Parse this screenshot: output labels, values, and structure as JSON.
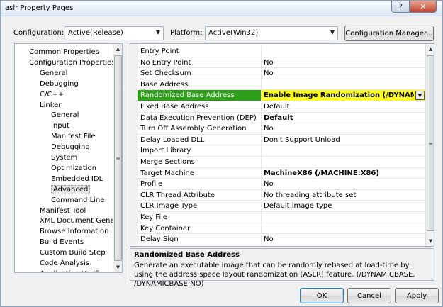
{
  "window": {
    "title": "aslr Property Pages"
  },
  "config": {
    "configuration_label": "Configuration:",
    "configuration_value": "Active(Release)",
    "platform_label": "Platform:",
    "platform_value": "Active(Win32)",
    "manager_button": "Configuration Manager..."
  },
  "tree": {
    "items": [
      {
        "label": "Common Properties",
        "level": 1
      },
      {
        "label": "Configuration Properties",
        "level": 1
      },
      {
        "label": "General",
        "level": 2
      },
      {
        "label": "Debugging",
        "level": 2
      },
      {
        "label": "C/C++",
        "level": 2
      },
      {
        "label": "Linker",
        "level": 2
      },
      {
        "label": "General",
        "level": 3
      },
      {
        "label": "Input",
        "level": 3
      },
      {
        "label": "Manifest File",
        "level": 3
      },
      {
        "label": "Debugging",
        "level": 3
      },
      {
        "label": "System",
        "level": 3
      },
      {
        "label": "Optimization",
        "level": 3
      },
      {
        "label": "Embedded IDL",
        "level": 3
      },
      {
        "label": "Advanced",
        "level": 3,
        "selected": true
      },
      {
        "label": "Command Line",
        "level": 3
      },
      {
        "label": "Manifest Tool",
        "level": 2
      },
      {
        "label": "XML Document Genera",
        "level": 2
      },
      {
        "label": "Browse Information",
        "level": 2
      },
      {
        "label": "Build Events",
        "level": 2
      },
      {
        "label": "Custom Build Step",
        "level": 2
      },
      {
        "label": "Code Analysis",
        "level": 2
      },
      {
        "label": "Application Verifi",
        "level": 2
      }
    ]
  },
  "properties": [
    {
      "name": "Entry Point",
      "value": ""
    },
    {
      "name": "No Entry Point",
      "value": "No"
    },
    {
      "name": "Set Checksum",
      "value": "No"
    },
    {
      "name": "Base Address",
      "value": ""
    },
    {
      "name": "Randomized Base Address",
      "value": "Enable Image Randomization (/DYNAMICBASE)",
      "selected": true
    },
    {
      "name": "Fixed Base Address",
      "value": "Default"
    },
    {
      "name": "Data Execution Prevention (DEP)",
      "value": "Default",
      "bold": true
    },
    {
      "name": "Turn Off Assembly Generation",
      "value": "No"
    },
    {
      "name": "Delay Loaded DLL",
      "value": "Don't Support Unload"
    },
    {
      "name": "Import Library",
      "value": ""
    },
    {
      "name": "Merge Sections",
      "value": ""
    },
    {
      "name": "Target Machine",
      "value": "MachineX86 (/MACHINE:X86)",
      "bold": true
    },
    {
      "name": "Profile",
      "value": "No"
    },
    {
      "name": "CLR Thread Attribute",
      "value": "No threading attribute set"
    },
    {
      "name": "CLR Image Type",
      "value": "Default image type"
    },
    {
      "name": "Key File",
      "value": ""
    },
    {
      "name": "Key Container",
      "value": ""
    },
    {
      "name": "Delay Sign",
      "value": "No"
    }
  ],
  "description": {
    "title": "Randomized Base Address",
    "text": "Generate an executable image that can be randomly rebased at load-time by using the address space layout randomization (ASLR) feature.     (/DYNAMICBASE, /DYNAMICBASE:NO)"
  },
  "buttons": {
    "ok": "OK",
    "cancel": "Cancel",
    "apply": "Apply"
  },
  "colors": {
    "selection_name_bg": "#2f9e1b",
    "selection_value_bg": "#ffff1f"
  }
}
